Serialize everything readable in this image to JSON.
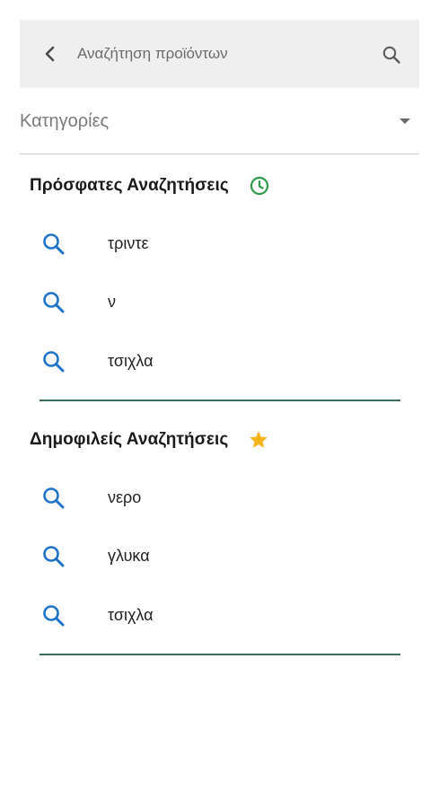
{
  "search": {
    "placeholder": "Αναζήτηση προϊόντων",
    "back_icon": "chevron-left-icon",
    "search_icon": "search-icon"
  },
  "category": {
    "label": "Κατηγορίες",
    "icon": "caret-down-icon"
  },
  "recent": {
    "title": "Πρόσφατες Αναζητήσεις",
    "icon": "clock-icon",
    "icon_color": "#2e9b4a",
    "items": [
      {
        "label": "τριντε"
      },
      {
        "label": "ν"
      },
      {
        "label": "τσιχλα"
      }
    ]
  },
  "popular": {
    "title": "Δημοφιλείς Αναζητήσεις",
    "icon": "star-icon",
    "icon_color": "#f3b51e",
    "items": [
      {
        "label": "νερο"
      },
      {
        "label": "γλυκα"
      },
      {
        "label": "τσιχλα"
      }
    ]
  },
  "colors": {
    "item_icon": "#1f73c8",
    "divider": "#3b6b5a",
    "search_bar_bg": "#efefef"
  }
}
